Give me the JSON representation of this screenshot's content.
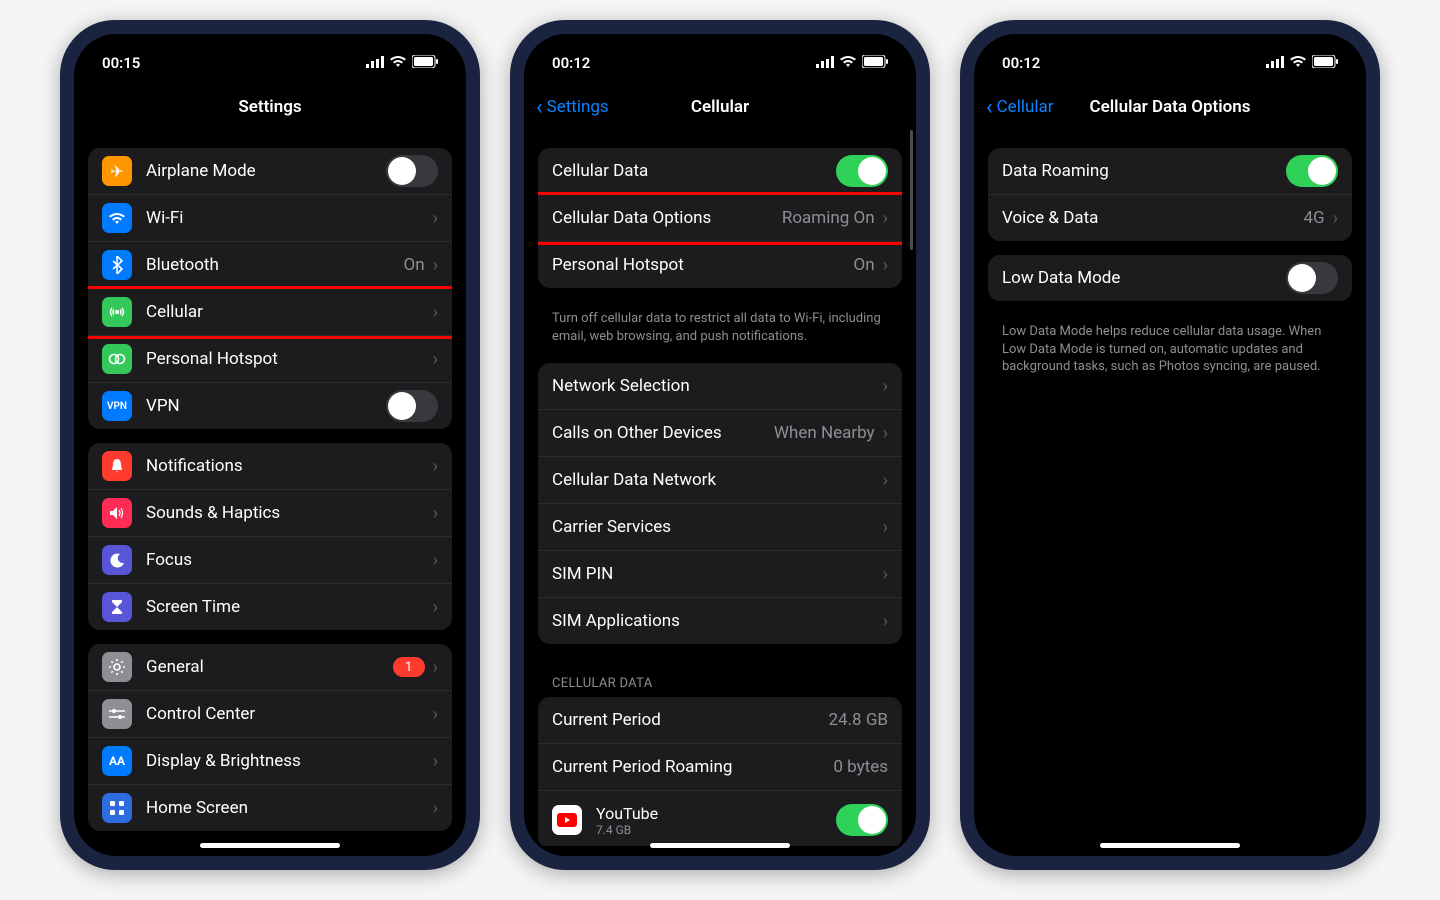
{
  "phone1": {
    "time": "00:15",
    "title": "Settings",
    "group1": [
      {
        "icon": "airplane",
        "bg": "#ff9500",
        "label": "Airplane Mode",
        "toggle": false
      },
      {
        "icon": "wifi",
        "bg": "#007aff",
        "label": "Wi-Fi",
        "chevron": true
      },
      {
        "icon": "bluetooth",
        "bg": "#007aff",
        "label": "Bluetooth",
        "detail": "On",
        "chevron": true
      },
      {
        "icon": "cellular",
        "bg": "#34c759",
        "label": "Cellular",
        "chevron": true,
        "highlight": true
      },
      {
        "icon": "hotspot",
        "bg": "#34c759",
        "label": "Personal Hotspot",
        "chevron": true
      },
      {
        "icon": "vpn",
        "bg": "#007aff",
        "label": "VPN",
        "toggle": false,
        "vpntext": "VPN"
      }
    ],
    "group2": [
      {
        "icon": "bell",
        "bg": "#ff3b30",
        "label": "Notifications",
        "chevron": true
      },
      {
        "icon": "speaker",
        "bg": "#ff2d55",
        "label": "Sounds & Haptics",
        "chevron": true
      },
      {
        "icon": "moon",
        "bg": "#5856d6",
        "label": "Focus",
        "chevron": true
      },
      {
        "icon": "hourglass",
        "bg": "#5856d6",
        "label": "Screen Time",
        "chevron": true
      }
    ],
    "group3": [
      {
        "icon": "gear",
        "bg": "#8e8e93",
        "label": "General",
        "badge": "1",
        "chevron": true
      },
      {
        "icon": "switches",
        "bg": "#8e8e93",
        "label": "Control Center",
        "chevron": true
      },
      {
        "icon": "aa",
        "bg": "#007aff",
        "label": "Display & Brightness",
        "chevron": true
      },
      {
        "icon": "grid",
        "bg": "#2d6bdf",
        "label": "Home Screen",
        "chevron": true
      }
    ]
  },
  "phone2": {
    "time": "00:12",
    "back": "Settings",
    "title": "Cellular",
    "group1": [
      {
        "label": "Cellular Data",
        "toggle": true
      },
      {
        "label": "Cellular Data Options",
        "detail": "Roaming On",
        "chevron": true,
        "highlight": true
      },
      {
        "label": "Personal Hotspot",
        "detail": "On",
        "chevron": true
      }
    ],
    "footer1": "Turn off cellular data to restrict all data to Wi-Fi, including email, web browsing, and push notifications.",
    "group2": [
      {
        "label": "Network Selection",
        "chevron": true
      },
      {
        "label": "Calls on Other Devices",
        "detail": "When Nearby",
        "chevron": true
      },
      {
        "label": "Cellular Data Network",
        "chevron": true
      },
      {
        "label": "Carrier Services",
        "chevron": true
      },
      {
        "label": "SIM PIN",
        "chevron": true
      },
      {
        "label": "SIM Applications",
        "chevron": true
      }
    ],
    "section_header": "CELLULAR DATA",
    "group3": [
      {
        "label": "Current Period",
        "detail": "24.8 GB"
      },
      {
        "label": "Current Period Roaming",
        "detail": "0 bytes"
      }
    ],
    "app": {
      "name": "YouTube",
      "size": "7.4 GB",
      "toggle": true
    }
  },
  "phone3": {
    "time": "00:12",
    "back": "Cellular",
    "title": "Cellular Data Options",
    "group1": [
      {
        "label": "Data Roaming",
        "toggle": true
      },
      {
        "label": "Voice & Data",
        "detail": "4G",
        "chevron": true
      }
    ],
    "group2": [
      {
        "label": "Low Data Mode",
        "toggle": false,
        "highlight": true
      }
    ],
    "footer2": "Low Data Mode helps reduce cellular data usage. When Low Data Mode is turned on, automatic updates and background tasks, such as Photos syncing, are paused."
  }
}
